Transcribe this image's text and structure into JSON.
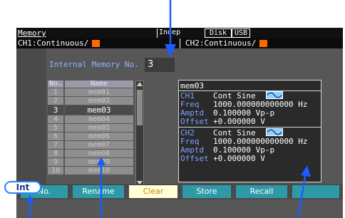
{
  "titlebar": {
    "menu": "Memory",
    "mode": "Indep",
    "disk": "Disk",
    "usb": "USB"
  },
  "channels": {
    "ch1": "CH1:Continuous/",
    "ch2": "CH2:Continuous/"
  },
  "internal_memory": {
    "label": "Internal Memory No.",
    "value": "3"
  },
  "list": {
    "col_no": "No.",
    "col_name": "Name",
    "rows": [
      {
        "no": "1",
        "name": "mem01"
      },
      {
        "no": "2",
        "name": "mem02"
      },
      {
        "no": "3",
        "name": "mem03"
      },
      {
        "no": "4",
        "name": "mem04"
      },
      {
        "no": "5",
        "name": "mem05"
      },
      {
        "no": "6",
        "name": "mem06"
      },
      {
        "no": "7",
        "name": "mem07"
      },
      {
        "no": "8",
        "name": "mem08"
      },
      {
        "no": "9",
        "name": "mem09"
      },
      {
        "no": "10",
        "name": "mem10"
      }
    ]
  },
  "detail": {
    "title": "mem03",
    "ch1": {
      "label": "CH1",
      "wave": "Cont Sine",
      "freq_label": "Freq",
      "freq": "1000.000000000000 Hz",
      "amptd_label": "Amptd",
      "amptd": "0.100000 Vp-p",
      "offset_label": "Offset",
      "offset": "+0.000000 V"
    },
    "ch2": {
      "label": "CH2",
      "wave": "Cont Sine",
      "freq_label": "Freq",
      "freq": "1000.000000000000 Hz",
      "amptd_label": "Amptd",
      "amptd": "0.100000 Vp-p",
      "offset_label": "Offset",
      "offset": "+0.000000 V"
    }
  },
  "softkeys": {
    "no": "No.",
    "rename": "Rename",
    "clear": "Clear",
    "store": "Store",
    "recall": "Recall"
  },
  "int_button": "Int",
  "colors": {
    "accent_orange": "#ff6a00",
    "annotation_blue": "#1a5cff",
    "softkey_teal": "#2e9aa8"
  }
}
